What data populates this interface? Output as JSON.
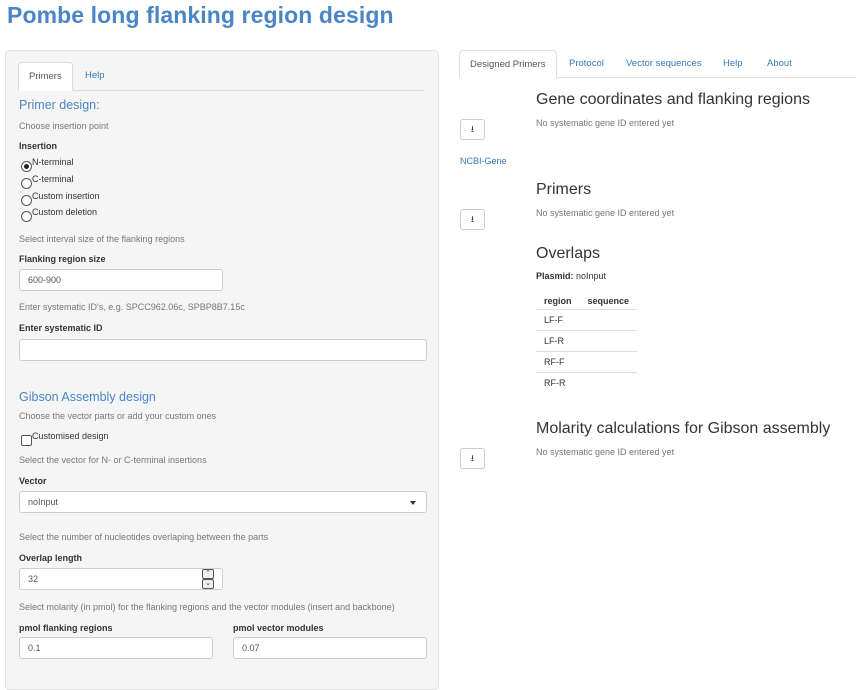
{
  "app_title": "Pombe long flanking region design",
  "sidebar": {
    "tabs": [
      "Primers",
      "Help"
    ],
    "primer_design_heading": "Primer design:",
    "insertion_help": "Choose insertion point",
    "insertion_label": "Insertion",
    "insertion_options": [
      "N-terminal",
      "C-terminal",
      "Custom insertion",
      "Custom deletion"
    ],
    "insertion_selected": "N-terminal",
    "interval_help": "Select interval size of the flanking regions",
    "flanking_label": "Flanking region size",
    "flanking_value": "600-900",
    "sysid_help": "Enter systematic ID's, e.g. SPCC962.06c, SPBP8B7.15c",
    "sysid_label": "Enter systematic ID",
    "sysid_value": "",
    "gibson_heading": "Gibson Assembly design",
    "vector_parts_help": "Choose the vector parts or add your custom ones",
    "customised_label": "Customised design",
    "customised_checked": false,
    "vector_help": "Select the vector for N- or C-terminal insertions",
    "vector_label": "Vector",
    "vector_value": "noInput",
    "overlap_help": "Select the number of nucleotides overlaping between the parts",
    "overlap_label": "Overlap length",
    "overlap_value": "32",
    "molarity_help": "Select molarity (in pmol) for the flanking regions and the vector modules (insert and backbone)",
    "pmol_flank_label": "pmol flanking regions",
    "pmol_flank_value": "0.1",
    "pmol_vector_label": "pmol vector modules",
    "pmol_vector_value": "0.07"
  },
  "main": {
    "tabs": [
      "Designed Primers",
      "Protocol",
      "Vector sequences",
      "Help",
      "About"
    ],
    "active_tab": "Designed Primers",
    "gene_title": "Gene coordinates and flanking regions",
    "gene_msg": "No systematic gene ID entered yet",
    "ncbi_link": "NCBI-Gene",
    "primers_title": "Primers",
    "primers_msg": "No systematic gene ID entered yet",
    "overlaps_title": "Overlaps",
    "plasmid_label": "Plasmid:",
    "plasmid_value": "noInput",
    "table_headers": [
      "region",
      "sequence"
    ],
    "table_rows": [
      "LF-F",
      "LF-R",
      "RF-F",
      "RF-R"
    ],
    "molarity_title": "Molarity calculations for Gibson assembly",
    "molarity_msg": "No systematic gene ID entered yet",
    "download_icon": "download-icon"
  },
  "colors": {
    "title": "#4a86c5",
    "link": "#337ab7",
    "well": "#f5f5f5"
  }
}
